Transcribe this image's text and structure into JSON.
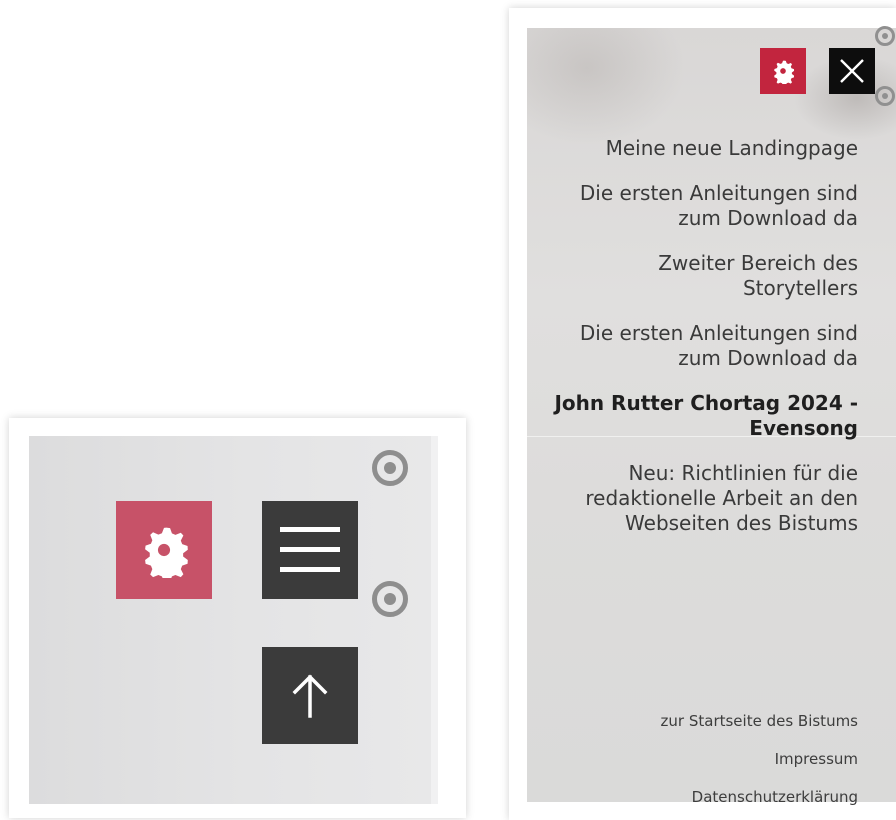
{
  "colors": {
    "accent_red": "#c75268",
    "accent_red_strong": "#c2253e",
    "dark_button": "#3b3b3b",
    "close_button": "#0d0d0d",
    "text": "#3a3a3a"
  },
  "left_panel": {
    "buttons": [
      {
        "name": "settings",
        "icon": "gear-icon"
      },
      {
        "name": "menu",
        "icon": "hamburger-menu-icon"
      },
      {
        "name": "scroll-to-top",
        "icon": "arrow-up-icon"
      }
    ],
    "markers": [
      "target-marker-icon",
      "target-marker-icon"
    ]
  },
  "drawer": {
    "top_buttons": [
      {
        "name": "settings",
        "icon": "gear-icon"
      },
      {
        "name": "close",
        "icon": "close-icon"
      }
    ],
    "nav_items": [
      {
        "label": "Meine neue Landingpage",
        "active": false
      },
      {
        "label": "Die ersten Anleitungen sind zum Download da",
        "active": false
      },
      {
        "label": "Zweiter Bereich des Storytellers",
        "active": false
      },
      {
        "label": "Die ersten Anleitungen sind zum Download da",
        "active": false
      },
      {
        "label": "John Rutter Chortag 2024 - Evensong",
        "active": true
      },
      {
        "label": "Neu: Richtlinien für die redaktionelle Arbeit an den Webseiten des Bistums",
        "active": false
      }
    ],
    "footer_links": [
      {
        "label": "zur Startseite des Bistums"
      },
      {
        "label": "Impressum"
      },
      {
        "label": "Datenschutzerklärung"
      }
    ]
  }
}
